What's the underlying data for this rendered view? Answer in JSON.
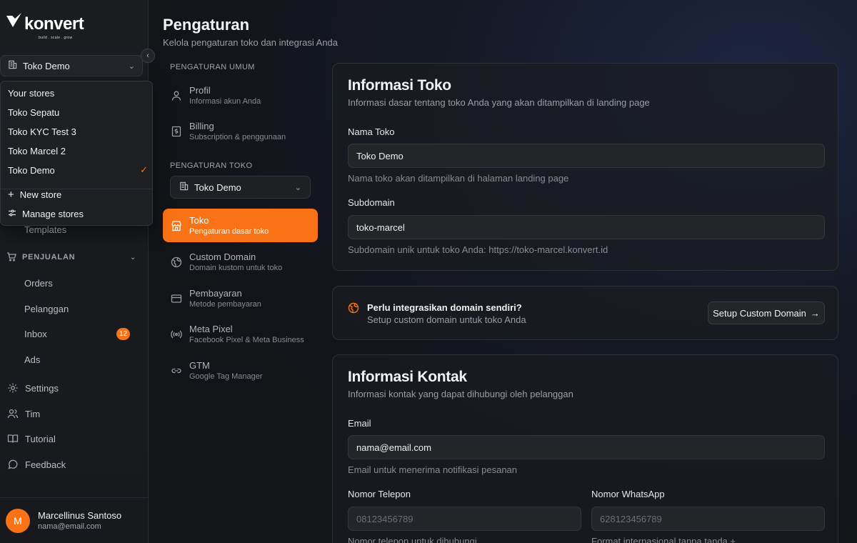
{
  "brand": {
    "name": "konvert",
    "tagline": "build . scale . grow"
  },
  "sidebar": {
    "store_select": "Toko Demo",
    "templates": "Templates",
    "section_sales": "PENJUALAN",
    "items": [
      {
        "label": "Orders"
      },
      {
        "label": "Pelanggan"
      },
      {
        "label": "Inbox",
        "badge": "12"
      },
      {
        "label": "Ads"
      }
    ],
    "bottom": [
      {
        "label": "Settings"
      },
      {
        "label": "Tim"
      },
      {
        "label": "Tutorial"
      },
      {
        "label": "Feedback"
      }
    ],
    "user": {
      "initial": "M",
      "name": "Marcellinus Santoso",
      "email": "nama@email.com"
    }
  },
  "dropdown": {
    "heading": "Your stores",
    "stores": [
      "Toko Sepatu",
      "Toko KYC Test 3",
      "Toko Marcel 2",
      "Toko Demo"
    ],
    "new_store": "New store",
    "manage_stores": "Manage stores"
  },
  "page": {
    "title": "Pengaturan",
    "subtitle": "Kelola pengaturan toko dan integrasi Anda"
  },
  "settings_nav": {
    "general_label": "PENGATURAN UMUM",
    "general": [
      {
        "title": "Profil",
        "sub": "Informasi akun Anda"
      },
      {
        "title": "Billing",
        "sub": "Subscription & penggunaan"
      }
    ],
    "store_label": "PENGATURAN TOKO",
    "store_select": "Toko Demo",
    "store": [
      {
        "title": "Toko",
        "sub": "Pengaturan dasar toko"
      },
      {
        "title": "Custom Domain",
        "sub": "Domain kustom untuk toko"
      },
      {
        "title": "Pembayaran",
        "sub": "Metode pembayaran"
      },
      {
        "title": "Meta Pixel",
        "sub": "Facebook Pixel & Meta Business"
      },
      {
        "title": "GTM",
        "sub": "Google Tag Manager"
      }
    ]
  },
  "store_info": {
    "title": "Informasi Toko",
    "subtitle": "Informasi dasar tentang toko Anda yang akan ditampilkan di landing page",
    "name_label": "Nama Toko",
    "name_value": "Toko Demo",
    "name_help": "Nama toko akan ditampilkan di halaman landing page",
    "subdomain_label": "Subdomain",
    "subdomain_value": "toko-marcel",
    "subdomain_help": "Subdomain unik untuk toko Anda: https://toko-marcel.konvert.id"
  },
  "domain_promo": {
    "title": "Perlu integrasikan domain sendiri?",
    "subtitle": "Setup custom domain untuk toko Anda",
    "button": "Setup Custom Domain"
  },
  "contact_info": {
    "title": "Informasi Kontak",
    "subtitle": "Informasi kontak yang dapat dihubungi oleh pelanggan",
    "email_label": "Email",
    "email_value": "nama@email.com",
    "email_help": "Email untuk menerima notifikasi pesanan",
    "phone_label": "Nomor Telepon",
    "phone_placeholder": "08123456789",
    "phone_help": "Nomor telepon untuk dihubungi",
    "wa_label": "Nomor WhatsApp",
    "wa_placeholder": "628123456789",
    "wa_help": "Format internasional tanpa tanda +"
  },
  "colors": {
    "accent": "#f97316",
    "background": "#121418",
    "card": "#1a1c21"
  }
}
